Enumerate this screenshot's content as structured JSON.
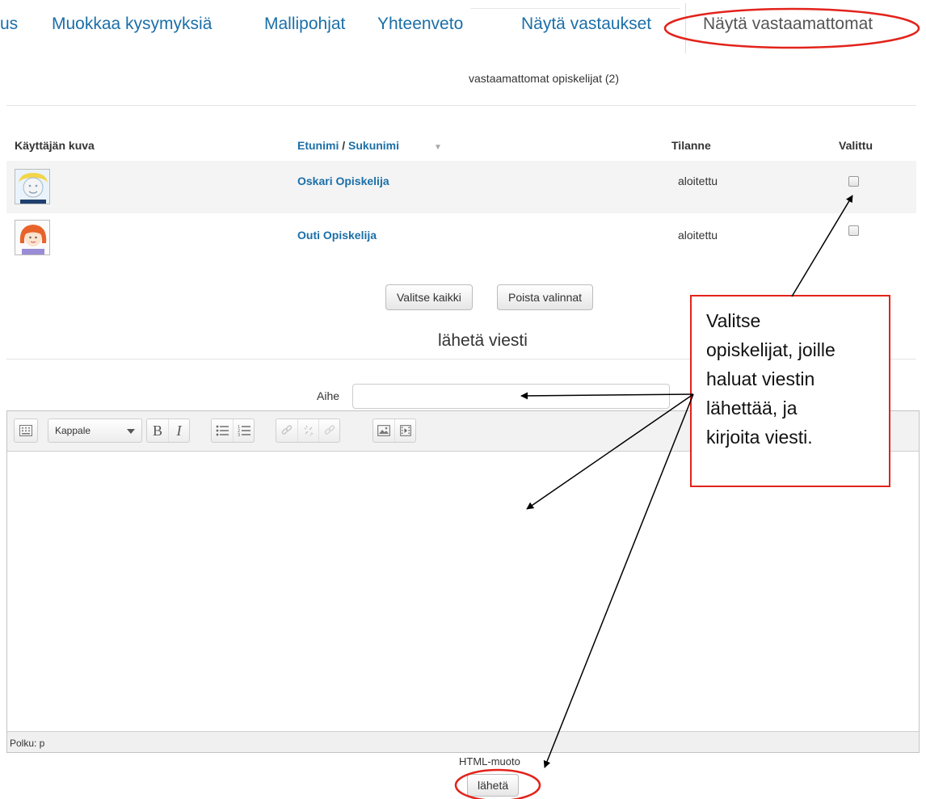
{
  "tabs": {
    "partial_first": "us",
    "items": [
      "Muokkaa kysymyksiä",
      "Mallipohjat",
      "Yhteenveto",
      "Näytä vastaukset",
      "Näytä vastaamattomat"
    ],
    "active_index": 4
  },
  "count_label": "vastaamattomat opiskelijat (2)",
  "table": {
    "headers": {
      "picture": "Käyttäjän kuva",
      "firstname": "Etunimi",
      "separator": " / ",
      "lastname": "Sukunimi",
      "status": "Tilanne",
      "selected": "Valittu"
    },
    "rows": [
      {
        "name": "Oskari Opiskelija",
        "status": "aloitettu",
        "checked": false
      },
      {
        "name": "Outi Opiskelija",
        "status": "aloitettu",
        "checked": false
      }
    ]
  },
  "buttons": {
    "select_all": "Valitse kaikki",
    "deselect": "Poista valinnat",
    "send": "lähetä"
  },
  "message": {
    "title": "lähetä viesti",
    "subject_label": "Aihe",
    "subject_value": ""
  },
  "editor": {
    "format_select": "Kappale",
    "path_label": "Polku: p",
    "format_mode": "HTML-muoto"
  },
  "callout": {
    "lines": [
      "Valitse",
      "opiskelijat, joille",
      "haluat viestin",
      "lähettää, ja",
      "kirjoita viesti."
    ]
  },
  "colors": {
    "link": "#1b6fa8",
    "highlight": "#e2231a"
  }
}
